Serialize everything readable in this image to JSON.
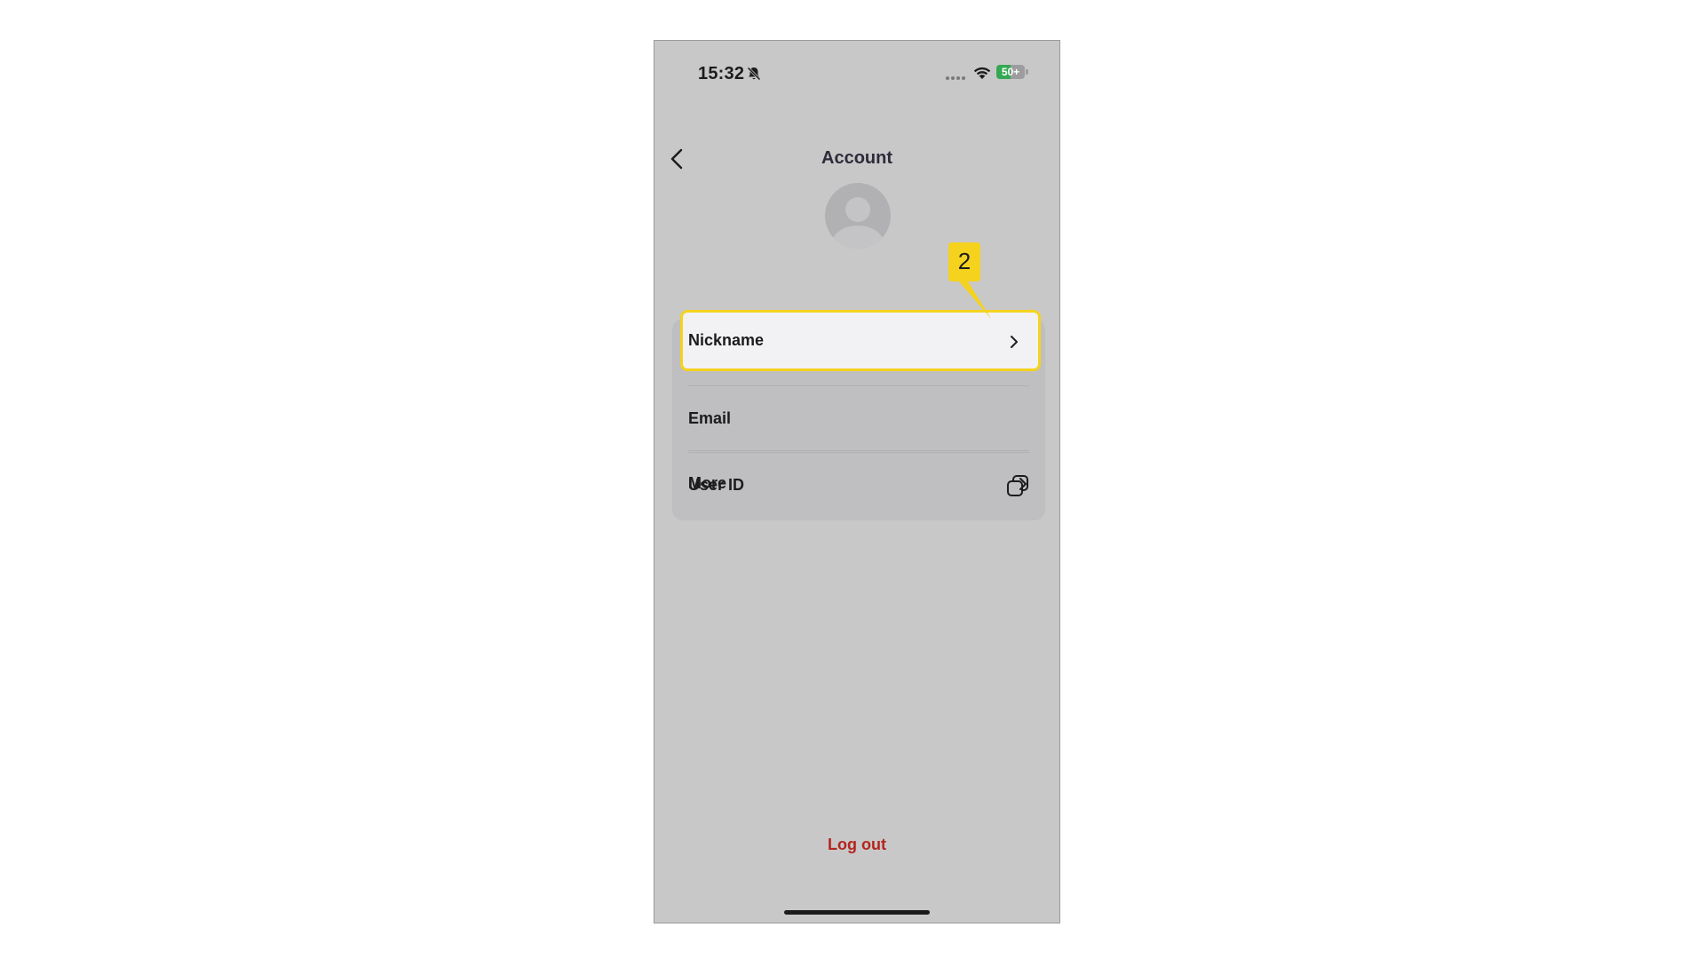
{
  "status_bar": {
    "time": "15:32",
    "battery_label": "50+",
    "battery_level": 0.5,
    "icons": [
      "bell-slash-icon",
      "signal-icon",
      "wifi-icon",
      "battery-icon"
    ]
  },
  "header": {
    "title": "Account",
    "back_icon": "chevron-left-icon"
  },
  "profile": {
    "avatar_icon": "default-user-avatar-icon"
  },
  "menu": {
    "items": [
      {
        "label": "Nickname",
        "trailing": "chevron-right-icon",
        "highlighted": true
      },
      {
        "label": "Email",
        "trailing": ""
      },
      {
        "label": "User ID",
        "trailing": "copy-icon"
      },
      {
        "label": "More",
        "trailing": "chevron-right-icon"
      }
    ]
  },
  "annotation": {
    "step_number": "2",
    "color": "#f5d21e"
  },
  "footer": {
    "logout_label": "Log out",
    "logout_color": "#b3261e"
  },
  "colors": {
    "screen_background": "#c8c8c9",
    "card_background": "#bfbfc1",
    "highlight_border": "#f5d21e",
    "battery_green": "#34a853"
  }
}
